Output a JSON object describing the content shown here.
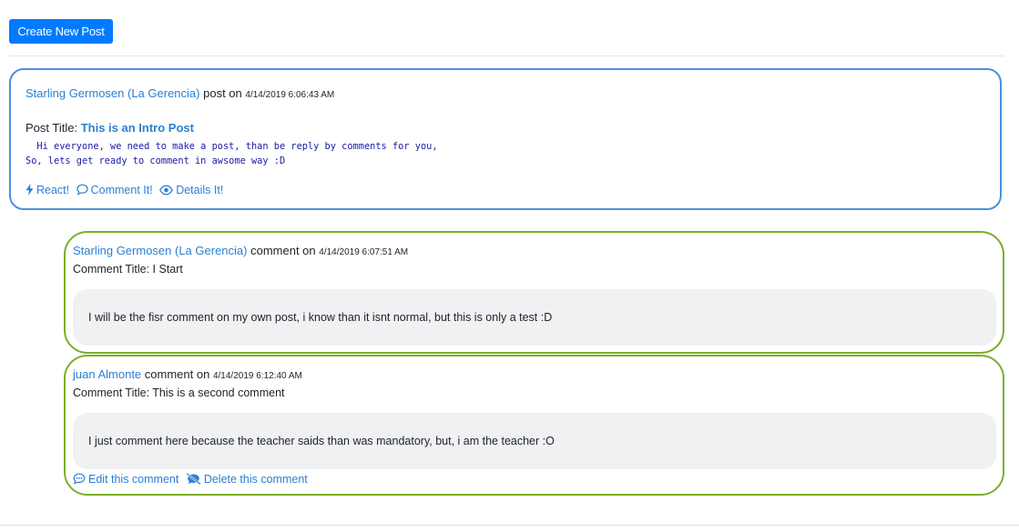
{
  "toolbar": {
    "create_label": "Create New Post"
  },
  "post": {
    "author": "Starling Germosen (La Gerencia)",
    "verb": "post on",
    "date": "4/14/2019 6:06:43 AM",
    "title_label": "Post Title:",
    "title": "This is an Intro Post",
    "body": "  Hi everyone, we need to make a post, than be reply by comments for you,\nSo, lets get ready to comment in awsome way :D",
    "actions": {
      "react": "React!",
      "comment": "Comment It!",
      "details": "Details It!"
    }
  },
  "comments": [
    {
      "author": "Starling Germosen (La Gerencia)",
      "verb": "comment on",
      "date": "4/14/2019 6:07:51 AM",
      "title_text": "Comment Title: I Start",
      "body": "I will be the fisr comment on my own post, i know than it isnt normal, but this is only a test :D"
    },
    {
      "author": "juan Almonte",
      "verb": "comment on",
      "date": "4/14/2019 6:12:40 AM",
      "title_text": "Comment Title: This is a second comment",
      "body": "I just comment here because the teacher saids than was mandatory, but, i am the teacher :O",
      "actions": {
        "edit": "Edit this comment",
        "delete": "Delete this comment"
      }
    }
  ],
  "colors": {
    "primary": "#007bff",
    "link": "#2a7fd4",
    "post_border": "#4a90e2",
    "comment_border": "#7cae2b",
    "code_text": "#1a1aa6"
  },
  "icons": {
    "react": "bolt-icon",
    "comment": "comment-bubble-icon",
    "details": "eye-icon",
    "edit": "chat-dots-icon",
    "delete": "comment-slash-icon"
  }
}
